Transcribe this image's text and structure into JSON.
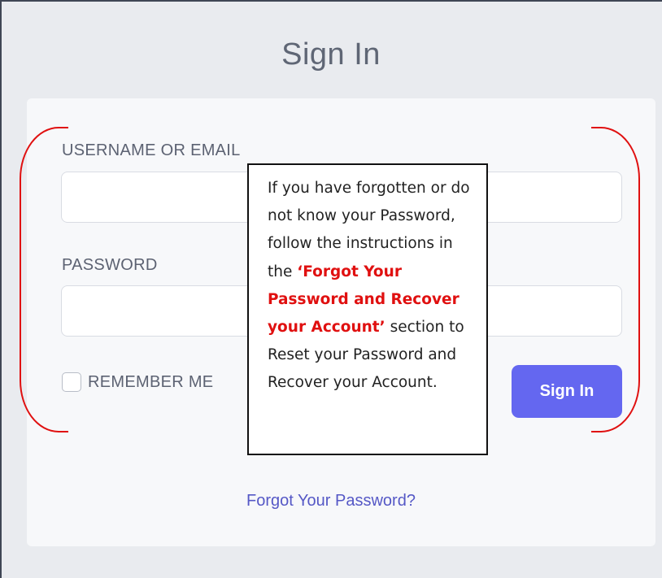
{
  "page": {
    "title": "Sign In"
  },
  "form": {
    "username_label": "USERNAME OR EMAIL",
    "username_value": "",
    "password_label": "PASSWORD",
    "password_value": "",
    "remember_label": "REMEMBER ME",
    "remember_checked": false,
    "signin_label": "Sign In",
    "forgot_link": "Forgot Your Password?"
  },
  "callout": {
    "text_before": "If you have forgotten or do not know your Password, follow the instructions in the ",
    "highlight": "‘Forgot Your Password and Recover your Account’",
    "text_after": " section to Reset your Password and Recover your Account."
  },
  "colors": {
    "accent": "#6467f0",
    "link": "#5558c6",
    "annotation": "#e01010",
    "background": "#e9ebef",
    "card": "#f7f8fa"
  }
}
